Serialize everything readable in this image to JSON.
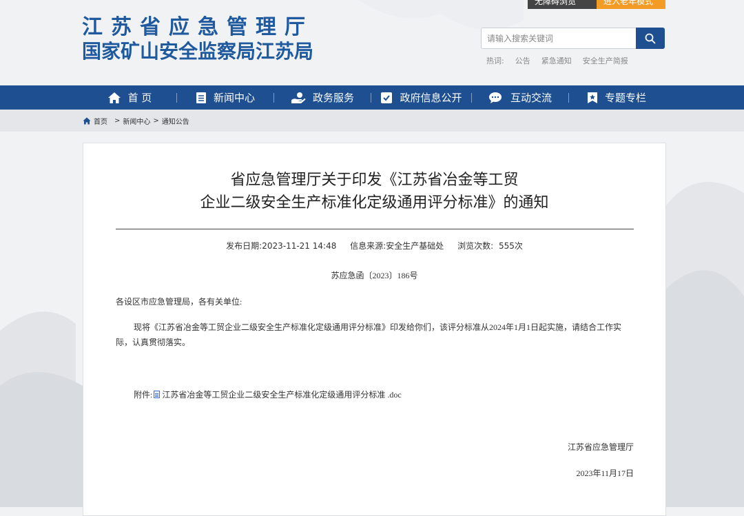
{
  "top_bar": {
    "barrier_free": "无障碍浏览",
    "elder_mode": "进入老年模式"
  },
  "logo": {
    "line1": "江苏省应急管理厅",
    "line2": "国家矿山安全监察局江苏局"
  },
  "search": {
    "placeholder": "请输入搜索关键词",
    "value": ""
  },
  "hotwords": {
    "label": "热词:",
    "items": [
      "公告",
      "紧急通知",
      "安全生产简报"
    ]
  },
  "nav": {
    "items": [
      {
        "label": "首 页",
        "icon": "home-icon"
      },
      {
        "label": "新闻中心",
        "icon": "document-icon"
      },
      {
        "label": "政务服务",
        "icon": "service-icon"
      },
      {
        "label": "政府信息公开",
        "icon": "check-doc-icon"
      },
      {
        "label": "互动交流",
        "icon": "chat-icon"
      },
      {
        "label": "专题专栏",
        "icon": "bookmark-icon"
      }
    ]
  },
  "breadcrumb": {
    "home": "首页",
    "sep": ">",
    "level1": "新闻中心",
    "level2": "通知公告"
  },
  "article": {
    "title_line1": "省应急管理厅关于印发《江苏省冶金等工贸",
    "title_line2": "企业二级安全生产标准化定级通用评分标准》的通知",
    "publish_label": "发布日期:",
    "publish_date": "2023-11-21 14:48",
    "source_label": "信息来源:",
    "source": "安全生产基础处",
    "views_label": "浏览次数:",
    "views": "555次",
    "doc_number": "苏应急函〔2023〕186号",
    "addressee": "各设区市应急管理局，各有关单位:",
    "body": "现将《江苏省冶金等工贸企业二级安全生产标准化定级通用评分标准》印发给你们，该评分标准从2024年1月1日起实施，请结合工作实际，认真贯彻落实。",
    "attachment_label": "附件:",
    "attachment_name": "江苏省冶金等工贸企业二级安全生产标准化定级通用评分标准 .doc",
    "signer": "江苏省应急管理厅",
    "sign_date": "2023年11月17日"
  }
}
